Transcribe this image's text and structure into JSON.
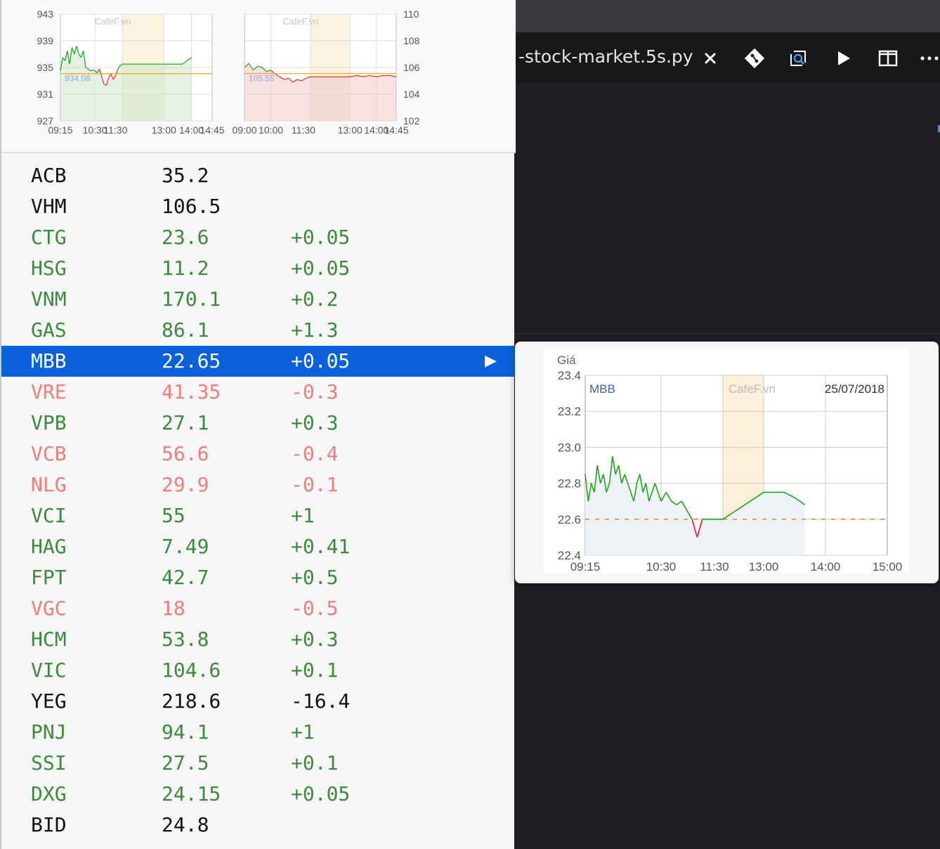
{
  "editor": {
    "tab_title": "-stock-market.5s.py",
    "icons": [
      "close-icon",
      "git-compare-icon",
      "open-preview-icon",
      "run-icon",
      "split-editor-icon",
      "more-actions-icon"
    ]
  },
  "colors": {
    "up": "#3c8a3c",
    "down": "#f07c7c",
    "reference": "#111111",
    "selected_bg": "#0a61d9"
  },
  "stocks": [
    {
      "symbol": "ACB",
      "price": "35.2",
      "change": "",
      "trend": "ref"
    },
    {
      "symbol": "VHM",
      "price": "106.5",
      "change": "",
      "trend": "ref"
    },
    {
      "symbol": "CTG",
      "price": "23.6",
      "change": "+0.05",
      "trend": "up"
    },
    {
      "symbol": "HSG",
      "price": "11.2",
      "change": "+0.05",
      "trend": "up"
    },
    {
      "symbol": "VNM",
      "price": "170.1",
      "change": "+0.2",
      "trend": "up"
    },
    {
      "symbol": "GAS",
      "price": "86.1",
      "change": "+1.3",
      "trend": "up"
    },
    {
      "symbol": "MBB",
      "price": "22.65",
      "change": "+0.05",
      "trend": "up",
      "selected": true
    },
    {
      "symbol": "VRE",
      "price": "41.35",
      "change": "-0.3",
      "trend": "down"
    },
    {
      "symbol": "VPB",
      "price": "27.1",
      "change": "+0.3",
      "trend": "up"
    },
    {
      "symbol": "VCB",
      "price": "56.6",
      "change": "-0.4",
      "trend": "down"
    },
    {
      "symbol": "NLG",
      "price": "29.9",
      "change": "-0.1",
      "trend": "down"
    },
    {
      "symbol": "VCI",
      "price": "55",
      "change": "+1",
      "trend": "up"
    },
    {
      "symbol": "HAG",
      "price": "7.49",
      "change": "+0.41",
      "trend": "up"
    },
    {
      "symbol": "FPT",
      "price": "42.7",
      "change": "+0.5",
      "trend": "up"
    },
    {
      "symbol": "VGC",
      "price": "18",
      "change": "-0.5",
      "trend": "down"
    },
    {
      "symbol": "HCM",
      "price": "53.8",
      "change": "+0.3",
      "trend": "up"
    },
    {
      "symbol": "VIC",
      "price": "104.6",
      "change": "+0.1",
      "trend": "up"
    },
    {
      "symbol": "YEG",
      "price": "218.6",
      "change": "-16.4",
      "trend": "ref"
    },
    {
      "symbol": "PNJ",
      "price": "94.1",
      "change": "+1",
      "trend": "up"
    },
    {
      "symbol": "SSI",
      "price": "27.5",
      "change": "+0.1",
      "trend": "up"
    },
    {
      "symbol": "DXG",
      "price": "24.15",
      "change": "+0.05",
      "trend": "up"
    },
    {
      "symbol": "BID",
      "price": "24.8",
      "change": "",
      "trend": "ref"
    }
  ],
  "chart_data": [
    {
      "type": "line",
      "watermark": "CafeF.vn",
      "yticks": [
        "943",
        "939",
        "935",
        "931",
        "927"
      ],
      "ylim": [
        927,
        943
      ],
      "xticks": [
        "09:15",
        "10:30",
        "11:30",
        "13:00",
        "14:00",
        "14:45"
      ],
      "reference_label": "934.08",
      "reference": 934.08,
      "x": [
        "09:15",
        "09:20",
        "09:25",
        "09:30",
        "09:35",
        "09:40",
        "09:45",
        "09:50",
        "09:55",
        "10:00",
        "10:05",
        "10:10",
        "10:15",
        "10:20",
        "10:25",
        "10:30",
        "10:35",
        "10:40",
        "10:45",
        "10:50",
        "10:55",
        "11:00",
        "11:05",
        "11:10",
        "11:15",
        "11:20",
        "11:25",
        "11:30",
        "13:00",
        "13:10",
        "13:20",
        "13:30",
        "13:40",
        "13:50",
        "14:00"
      ],
      "y": [
        934.5,
        936.5,
        936,
        937.5,
        935.5,
        938,
        937,
        938.2,
        937,
        936.5,
        937.5,
        935,
        934.8,
        934.5,
        934.6,
        934.5,
        934.2,
        934.8,
        933.5,
        932.5,
        932.3,
        933.5,
        934,
        933.2,
        933.8,
        934.8,
        935.3,
        935.5,
        935.5,
        935.5,
        935.5,
        935.5,
        935.5,
        936,
        936.5
      ]
    },
    {
      "type": "line",
      "watermark": "CafeF.vn",
      "yticks": [
        "110",
        "108",
        "106",
        "104",
        "102"
      ],
      "ylim": [
        102,
        110
      ],
      "xticks": [
        "09:00",
        "10:00",
        "11:30",
        "13:00",
        "14:00",
        "14:45"
      ],
      "reference_label": "105.55",
      "reference": 105.55,
      "x": [
        "09:00",
        "09:10",
        "09:20",
        "09:30",
        "09:40",
        "09:50",
        "10:00",
        "10:10",
        "10:20",
        "10:30",
        "10:40",
        "10:50",
        "11:00",
        "11:10",
        "11:20",
        "11:30",
        "13:00",
        "13:15",
        "13:30",
        "13:45",
        "14:00",
        "14:15",
        "14:30",
        "14:45"
      ],
      "y": [
        106,
        106.3,
        105.8,
        106.1,
        106,
        105.7,
        105.8,
        105.5,
        105.3,
        105.1,
        105.2,
        104.9,
        105.1,
        105,
        105.2,
        105.3,
        105.3,
        105.4,
        105.3,
        105.4,
        105.3,
        105.4,
        105.4,
        105.3
      ]
    },
    {
      "type": "line",
      "title": "MBB",
      "watermark": "CafeF.vn",
      "date": "25/07/2018",
      "ylabel": "Giá",
      "yticks": [
        "23.4",
        "23.2",
        "23.0",
        "22.8",
        "22.6",
        "22.4"
      ],
      "ylim": [
        22.4,
        23.4
      ],
      "xticks": [
        "09:15",
        "10:30",
        "11:30",
        "13:00",
        "14:00",
        "15:00"
      ],
      "reference": 22.6,
      "x": [
        "09:15",
        "09:18",
        "09:21",
        "09:24",
        "09:27",
        "09:30",
        "09:33",
        "09:36",
        "09:39",
        "09:42",
        "09:45",
        "09:48",
        "09:51",
        "09:54",
        "09:57",
        "10:00",
        "10:03",
        "10:06",
        "10:09",
        "10:12",
        "10:15",
        "10:18",
        "10:21",
        "10:24",
        "10:27",
        "10:30",
        "10:35",
        "10:40",
        "10:45",
        "10:50",
        "10:55",
        "11:00",
        "11:05",
        "11:10",
        "11:15",
        "11:20",
        "11:25",
        "11:30",
        "13:00",
        "13:10",
        "13:20",
        "13:30",
        "13:40"
      ],
      "y": [
        22.85,
        22.7,
        22.8,
        22.75,
        22.9,
        22.8,
        22.85,
        22.75,
        22.8,
        22.95,
        22.85,
        22.9,
        22.8,
        22.85,
        22.8,
        22.75,
        22.7,
        22.8,
        22.85,
        22.75,
        22.8,
        22.7,
        22.75,
        22.8,
        22.75,
        22.7,
        22.75,
        22.7,
        22.68,
        22.7,
        22.65,
        22.6,
        22.5,
        22.6,
        22.6,
        22.6,
        22.6,
        22.6,
        22.75,
        22.75,
        22.75,
        22.72,
        22.68
      ]
    }
  ]
}
